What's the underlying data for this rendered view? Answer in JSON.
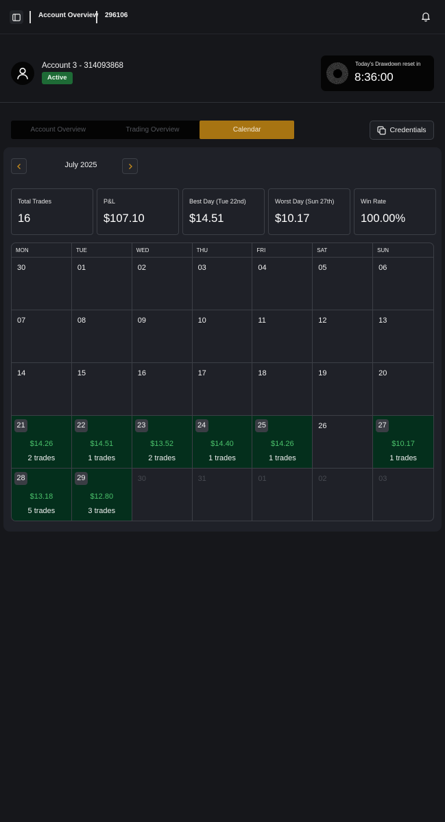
{
  "header": {
    "title": "Account Overview",
    "account_id": "296106"
  },
  "account": {
    "name": "Account 3 - 314093868",
    "status": "Active",
    "status_color": "#1e6b36",
    "reset_label": "Today's Drawdown reset in",
    "reset_time": "8:36:00"
  },
  "tabs": [
    {
      "label": "Account Overview",
      "active": false
    },
    {
      "label": "Trading Overview",
      "active": false
    },
    {
      "label": "Calendar",
      "active": true
    }
  ],
  "accent_color": "#a77412",
  "credentials_label": "Credentials",
  "calendar": {
    "month_label": "July 2025",
    "stats": [
      {
        "label": "Total Trades",
        "value": "16"
      },
      {
        "label": "P&L",
        "value": "$107.10"
      },
      {
        "label": "Best Day (Tue 22nd)",
        "value": "$14.51"
      },
      {
        "label": "Worst Day (Sun 27th)",
        "value": "$10.17"
      },
      {
        "label": "Win Rate",
        "value": "100.00%"
      }
    ],
    "weekdays": [
      "MON",
      "TUE",
      "WED",
      "THU",
      "FRI",
      "SAT",
      "SUN"
    ],
    "days": [
      {
        "day": "30"
      },
      {
        "day": "01"
      },
      {
        "day": "02"
      },
      {
        "day": "03"
      },
      {
        "day": "04"
      },
      {
        "day": "05"
      },
      {
        "day": "06"
      },
      {
        "day": "07"
      },
      {
        "day": "08"
      },
      {
        "day": "09"
      },
      {
        "day": "10"
      },
      {
        "day": "11"
      },
      {
        "day": "12"
      },
      {
        "day": "13"
      },
      {
        "day": "14"
      },
      {
        "day": "15"
      },
      {
        "day": "16"
      },
      {
        "day": "17"
      },
      {
        "day": "18"
      },
      {
        "day": "19"
      },
      {
        "day": "20"
      },
      {
        "day": "21",
        "pnl": "$14.26",
        "trades": "2 trades"
      },
      {
        "day": "22",
        "pnl": "$14.51",
        "trades": "1 trades"
      },
      {
        "day": "23",
        "pnl": "$13.52",
        "trades": "2 trades"
      },
      {
        "day": "24",
        "pnl": "$14.40",
        "trades": "1 trades"
      },
      {
        "day": "25",
        "pnl": "$14.26",
        "trades": "1 trades"
      },
      {
        "day": "26"
      },
      {
        "day": "27",
        "pnl": "$10.17",
        "trades": "1 trades"
      },
      {
        "day": "28",
        "pnl": "$13.18",
        "trades": "5 trades"
      },
      {
        "day": "29",
        "pnl": "$12.80",
        "trades": "3 trades"
      },
      {
        "day": "30",
        "muted": true
      },
      {
        "day": "31",
        "muted": true
      },
      {
        "day": "01",
        "muted": true
      },
      {
        "day": "02",
        "muted": true
      },
      {
        "day": "03",
        "muted": true
      }
    ],
    "profit_color": "#4ac06a",
    "profit_day_bg": "#042f1c"
  }
}
